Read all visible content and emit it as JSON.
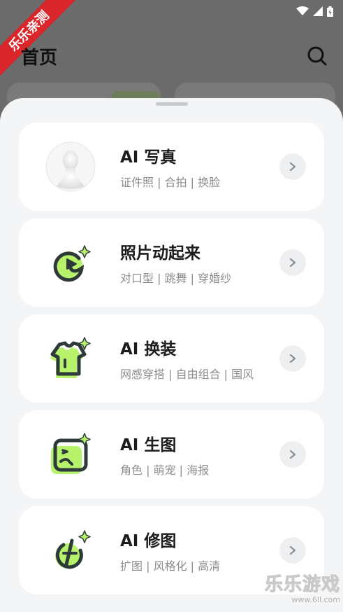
{
  "corner_badge": {
    "text": "乐乐亲测"
  },
  "header": {
    "title": "首页",
    "search_icon": "search-icon"
  },
  "features": [
    {
      "title": "AI 写真",
      "subtitle": "证件照 | 合拍 | 换脸",
      "icon": "mannequin-icon"
    },
    {
      "title": "照片动起来",
      "subtitle": "对口型 | 跳舞 | 穿婚纱",
      "icon": "play-sparkle-icon"
    },
    {
      "title": "AI 换装",
      "subtitle": "网感穿搭 | 自由组合 | 国风",
      "icon": "shirt-sparkle-icon"
    },
    {
      "title": "AI 生图",
      "subtitle": "角色 | 萌宠 | 海报",
      "icon": "image-sparkle-icon"
    },
    {
      "title": "AI 修图",
      "subtitle": "扩图 | 风格化 | 高清",
      "icon": "edit-sparkle-icon"
    }
  ],
  "watermark": {
    "main": "乐乐游戏",
    "url": "www.6ll.com"
  },
  "colors": {
    "accent_green": "#b6f26a",
    "icon_dark": "#2e3a3a",
    "card_bg": "#ffffff",
    "sheet_bg": "#f4f5f7"
  }
}
